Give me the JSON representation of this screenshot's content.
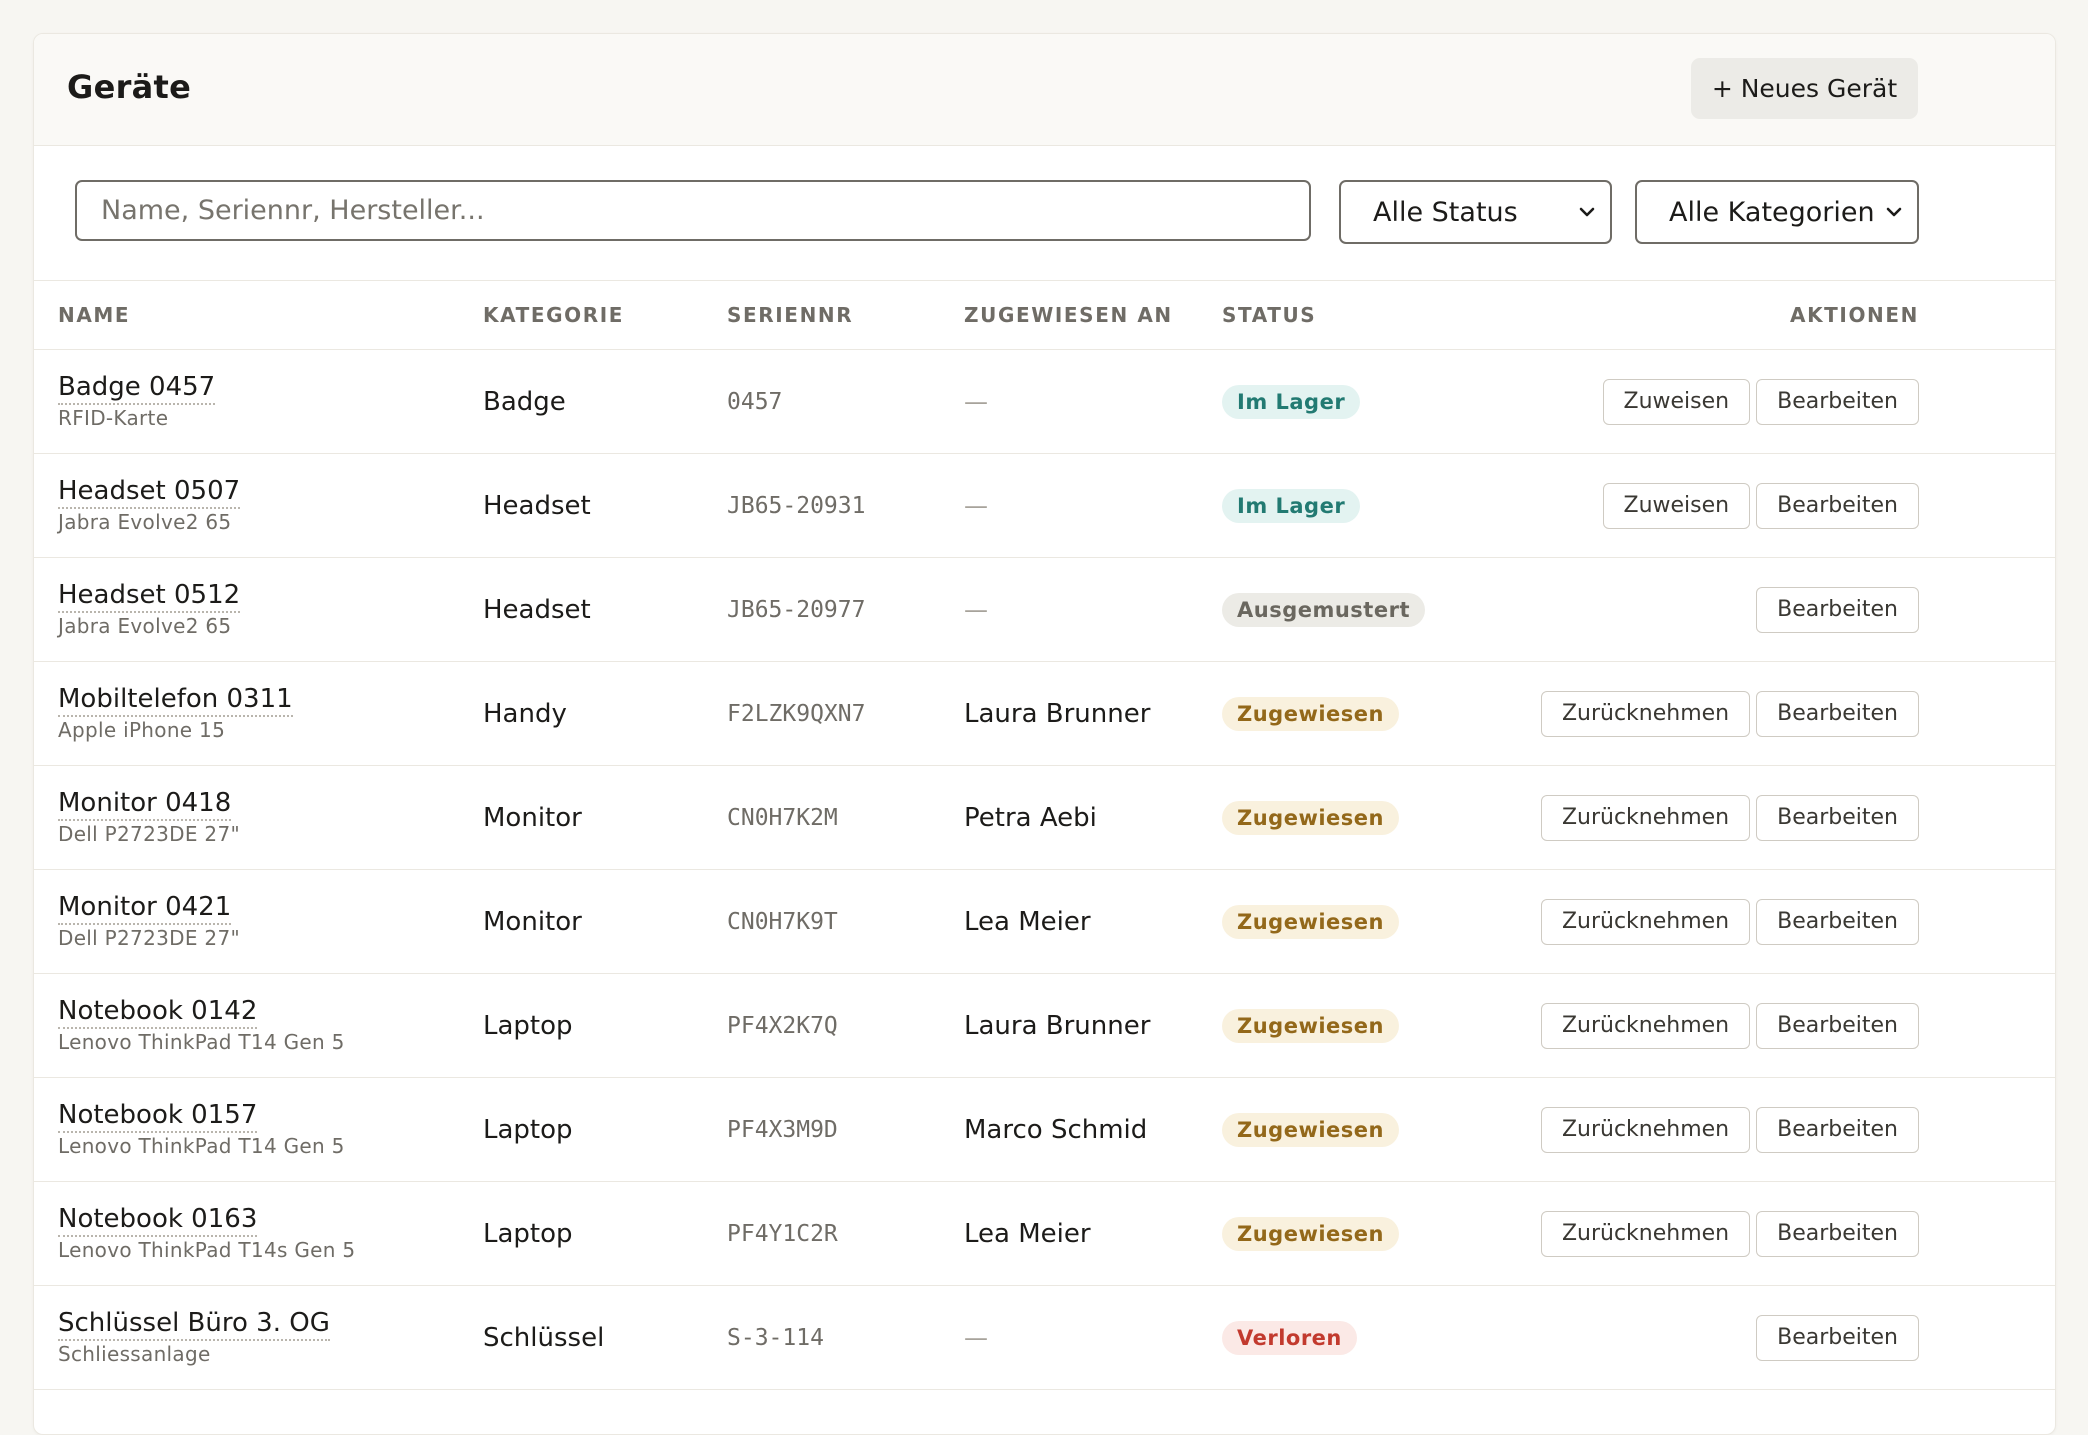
{
  "header": {
    "title": "Geräte",
    "new_device_label": "+ Neues Gerät"
  },
  "filters": {
    "search_placeholder": "Name, Seriennr, Hersteller...",
    "search_value": "",
    "status_selected": "Alle Status",
    "category_selected": "Alle Kategorien"
  },
  "table": {
    "headers": {
      "name": "NAME",
      "kategorie": "KATEGORIE",
      "seriennr": "SERIENNR",
      "zugewiesen": "ZUGEWIESEN AN",
      "status": "STATUS",
      "aktionen": "AKTIONEN"
    },
    "rows": [
      {
        "name": "Badge 0457",
        "model": "RFID-Karte",
        "kategorie": "Badge",
        "seriennr": "0457",
        "zugewiesen": "—",
        "status": "Im Lager",
        "status_type": "lager",
        "actions": [
          "Zuweisen",
          "Bearbeiten"
        ]
      },
      {
        "name": "Headset 0507",
        "model": "Jabra Evolve2 65",
        "kategorie": "Headset",
        "seriennr": "JB65-20931",
        "zugewiesen": "—",
        "status": "Im Lager",
        "status_type": "lager",
        "actions": [
          "Zuweisen",
          "Bearbeiten"
        ]
      },
      {
        "name": "Headset 0512",
        "model": "Jabra Evolve2 65",
        "kategorie": "Headset",
        "seriennr": "JB65-20977",
        "zugewiesen": "—",
        "status": "Ausgemustert",
        "status_type": "aus",
        "actions": [
          "Bearbeiten"
        ]
      },
      {
        "name": "Mobiltelefon 0311",
        "model": "Apple iPhone 15",
        "kategorie": "Handy",
        "seriennr": "F2LZK9QXN7",
        "zugewiesen": "Laura Brunner",
        "status": "Zugewiesen",
        "status_type": "zug",
        "actions": [
          "Zurücknehmen",
          "Bearbeiten"
        ]
      },
      {
        "name": "Monitor 0418",
        "model": "Dell P2723DE 27\"",
        "kategorie": "Monitor",
        "seriennr": "CN0H7K2M",
        "zugewiesen": "Petra Aebi",
        "status": "Zugewiesen",
        "status_type": "zug",
        "actions": [
          "Zurücknehmen",
          "Bearbeiten"
        ]
      },
      {
        "name": "Monitor 0421",
        "model": "Dell P2723DE 27\"",
        "kategorie": "Monitor",
        "seriennr": "CN0H7K9T",
        "zugewiesen": "Lea Meier",
        "status": "Zugewiesen",
        "status_type": "zug",
        "actions": [
          "Zurücknehmen",
          "Bearbeiten"
        ]
      },
      {
        "name": "Notebook 0142",
        "model": "Lenovo ThinkPad T14 Gen 5",
        "kategorie": "Laptop",
        "seriennr": "PF4X2K7Q",
        "zugewiesen": "Laura Brunner",
        "status": "Zugewiesen",
        "status_type": "zug",
        "actions": [
          "Zurücknehmen",
          "Bearbeiten"
        ]
      },
      {
        "name": "Notebook 0157",
        "model": "Lenovo ThinkPad T14 Gen 5",
        "kategorie": "Laptop",
        "seriennr": "PF4X3M9D",
        "zugewiesen": "Marco Schmid",
        "status": "Zugewiesen",
        "status_type": "zug",
        "actions": [
          "Zurücknehmen",
          "Bearbeiten"
        ]
      },
      {
        "name": "Notebook 0163",
        "model": "Lenovo ThinkPad T14s Gen 5",
        "kategorie": "Laptop",
        "seriennr": "PF4Y1C2R",
        "zugewiesen": "Lea Meier",
        "status": "Zugewiesen",
        "status_type": "zug",
        "actions": [
          "Zurücknehmen",
          "Bearbeiten"
        ]
      },
      {
        "name": "Schlüssel Büro 3. OG",
        "model": "Schliessanlage",
        "kategorie": "Schlüssel",
        "seriennr": "S-3-114",
        "zugewiesen": "—",
        "status": "Verloren",
        "status_type": "ver",
        "actions": [
          "Bearbeiten"
        ]
      }
    ]
  },
  "colors": {
    "lager": "#227a72",
    "ausgemustert": "#6a675f",
    "zugewiesen": "#93681a",
    "verloren": "#c23a2e"
  },
  "icons": {
    "select_chevron": "chevron-down-icon"
  }
}
